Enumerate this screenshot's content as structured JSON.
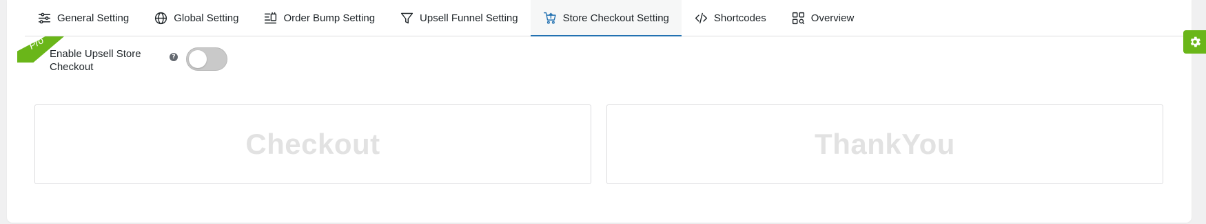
{
  "tabs": [
    {
      "label": "General Setting",
      "icon": "sliders-icon",
      "active": false
    },
    {
      "label": "Global Setting",
      "icon": "globe-icon",
      "active": false
    },
    {
      "label": "Order Bump Setting",
      "icon": "order-bump-icon",
      "active": false
    },
    {
      "label": "Upsell Funnel Setting",
      "icon": "funnel-icon",
      "active": false
    },
    {
      "label": "Store Checkout Setting",
      "icon": "cart-upload-icon",
      "active": true
    },
    {
      "label": "Shortcodes",
      "icon": "code-icon",
      "active": false
    },
    {
      "label": "Overview",
      "icon": "grid-search-icon",
      "active": false
    }
  ],
  "setting": {
    "badge": "Pro",
    "label": "Enable Upsell Store Checkout",
    "help": "?",
    "enabled": false
  },
  "cards": {
    "checkout": "Checkout",
    "thankyou": "ThankYou"
  },
  "colors": {
    "accent": "#2271b1",
    "pro_green": "#6ab619",
    "toggle_off": "#c9c9c9",
    "card_text": "#e2e2e2"
  },
  "floating_button": {
    "icon": "gear-icon"
  }
}
